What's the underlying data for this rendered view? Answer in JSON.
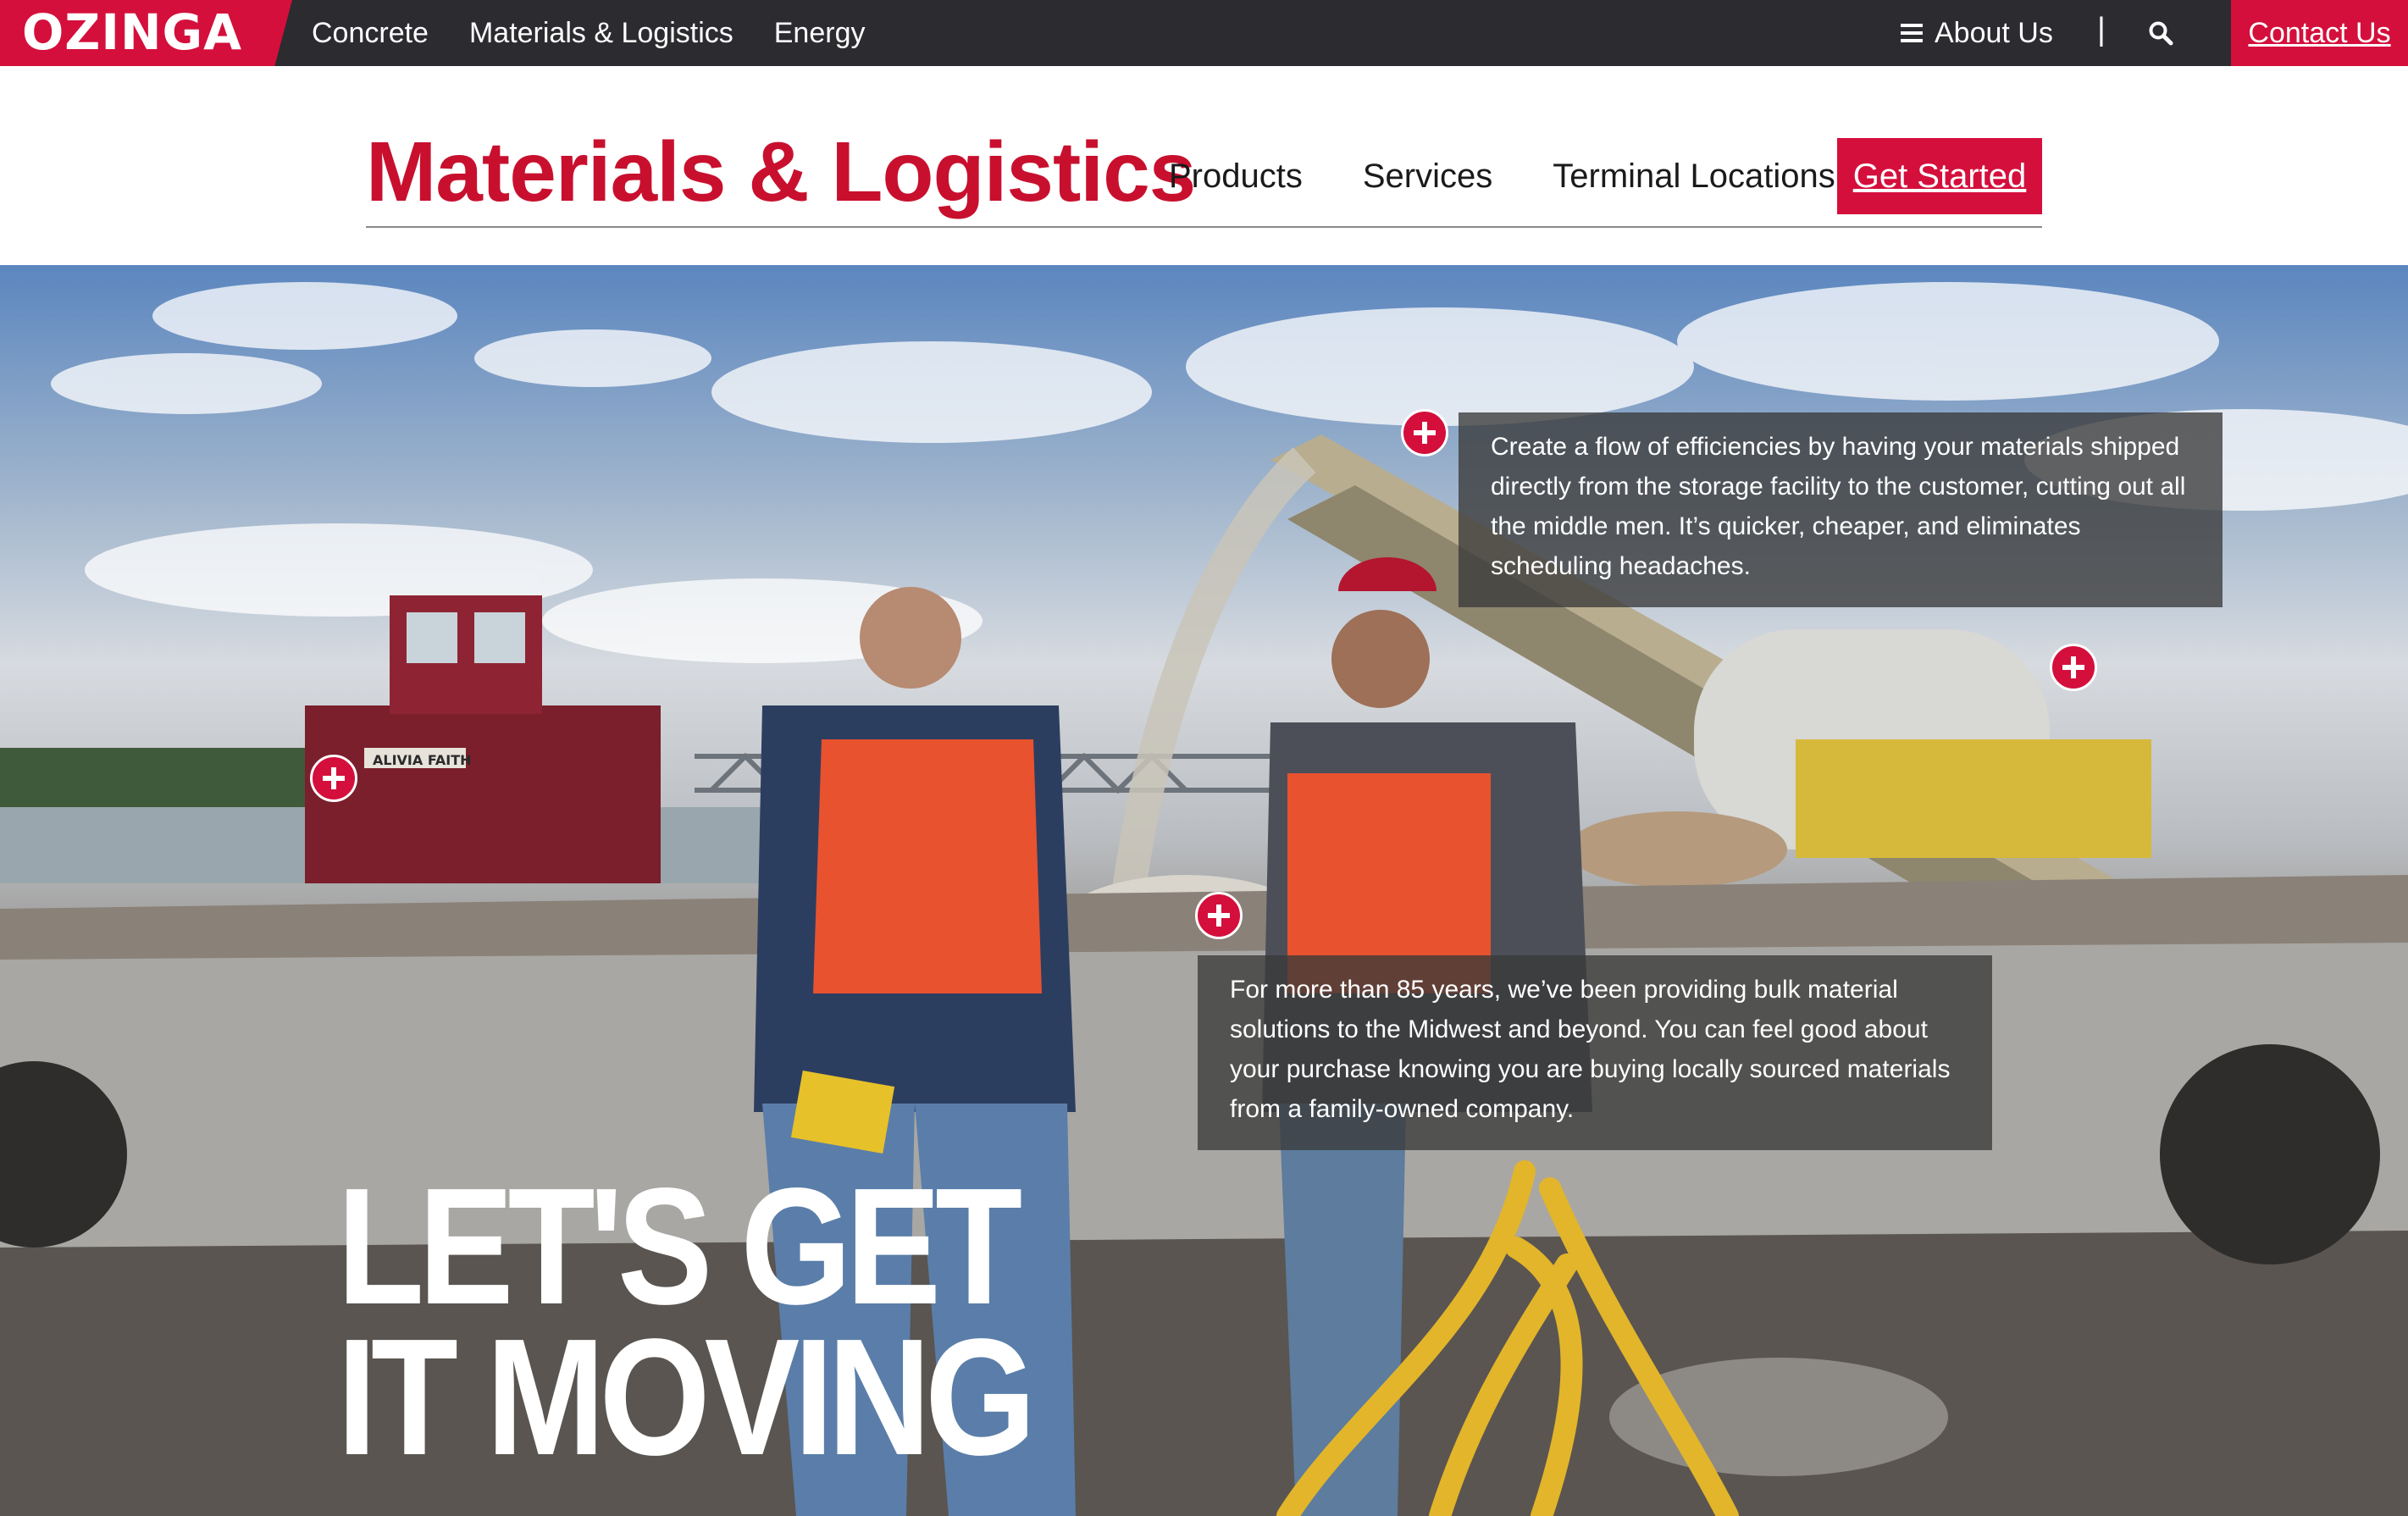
{
  "brand": {
    "logo_text": "OZINGA",
    "accent_color": "#d40f3c",
    "topbar_color": "#2b2b30"
  },
  "topbar": {
    "nav": [
      "Concrete",
      "Materials & Logistics",
      "Energy"
    ],
    "about_label": "About Us",
    "separator": "|",
    "search_icon": "search-icon",
    "menu_icon": "hamburger-icon",
    "contact_label": "Contact Us"
  },
  "subheader": {
    "title": "Materials & Logistics",
    "nav": [
      "Products",
      "Services",
      "Terminal Locations"
    ],
    "cta_label": "Get Started"
  },
  "hero": {
    "callout_1": "Create a flow of efficiencies by having your materials shipped directly from the storage facility to the customer, cutting out all the middle men. It’s quicker, cheaper, and eliminates scheduling headaches.",
    "callout_2": "For more than 85 years, we’ve been providing bulk material solutions to the Midwest and beyond. You can feel good about your purchase knowing you are buying locally sourced materials from a family-owned company.",
    "headline_line1": "LET'S GET",
    "headline_line2": "IT MOVING",
    "boat_name": "ALIVIA FAITH",
    "hotspot_icon": "plus-icon"
  }
}
